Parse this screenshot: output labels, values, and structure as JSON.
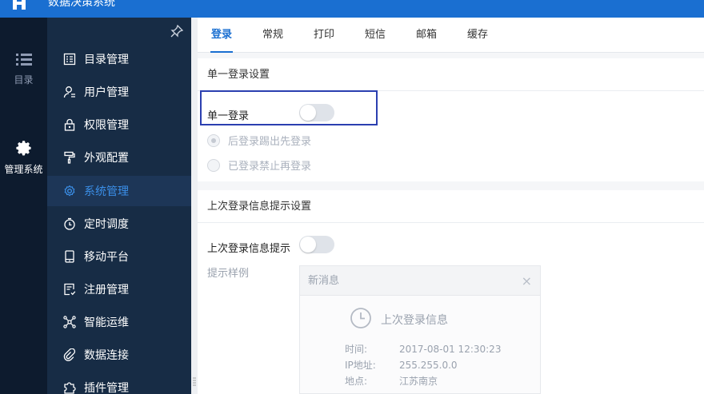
{
  "app": {
    "title": "数据决策系统"
  },
  "rail": {
    "items": [
      {
        "label": "目录",
        "icon": "list-icon"
      },
      {
        "label": "管理系统",
        "icon": "gear-icon"
      }
    ]
  },
  "menu": {
    "items": [
      {
        "label": "目录管理",
        "icon": "catalog-icon"
      },
      {
        "label": "用户管理",
        "icon": "user-icon"
      },
      {
        "label": "权限管理",
        "icon": "lock-icon"
      },
      {
        "label": "外观配置",
        "icon": "paint-roller-icon"
      },
      {
        "label": "系统管理",
        "icon": "gear-icon",
        "active": true
      },
      {
        "label": "定时调度",
        "icon": "timer-icon"
      },
      {
        "label": "移动平台",
        "icon": "mobile-icon"
      },
      {
        "label": "注册管理",
        "icon": "register-icon"
      },
      {
        "label": "智能运维",
        "icon": "network-icon"
      },
      {
        "label": "数据连接",
        "icon": "link-icon"
      },
      {
        "label": "插件管理",
        "icon": "puzzle-icon"
      }
    ]
  },
  "tabs": [
    {
      "label": "登录",
      "active": true
    },
    {
      "label": "常规"
    },
    {
      "label": "打印"
    },
    {
      "label": "短信"
    },
    {
      "label": "邮箱"
    },
    {
      "label": "缓存"
    }
  ],
  "single_login": {
    "section_title": "单一登录设置",
    "toggle_label": "单一登录",
    "enabled": false,
    "options": [
      {
        "label": "后登录踢出先登录",
        "selected": true
      },
      {
        "label": "已登录禁止再登录",
        "selected": false
      }
    ]
  },
  "last_login": {
    "section_title": "上次登录信息提示设置",
    "toggle_label": "上次登录信息提示",
    "enabled": false,
    "example_label": "提示样例",
    "notice": {
      "header": "新消息",
      "close": "×",
      "title": "上次登录信息",
      "rows": [
        {
          "key": "时间:",
          "value": "2017-08-01 12:30:23"
        },
        {
          "key": "IP地址:",
          "value": "255.255.0.0"
        },
        {
          "key": "地点:",
          "value": "江苏南京"
        }
      ]
    }
  },
  "colors": {
    "accent": "#1a6fd1",
    "menu_bg": "#172c45",
    "rail_bg": "#0d1b2e",
    "highlight": "#2b3fb0"
  }
}
